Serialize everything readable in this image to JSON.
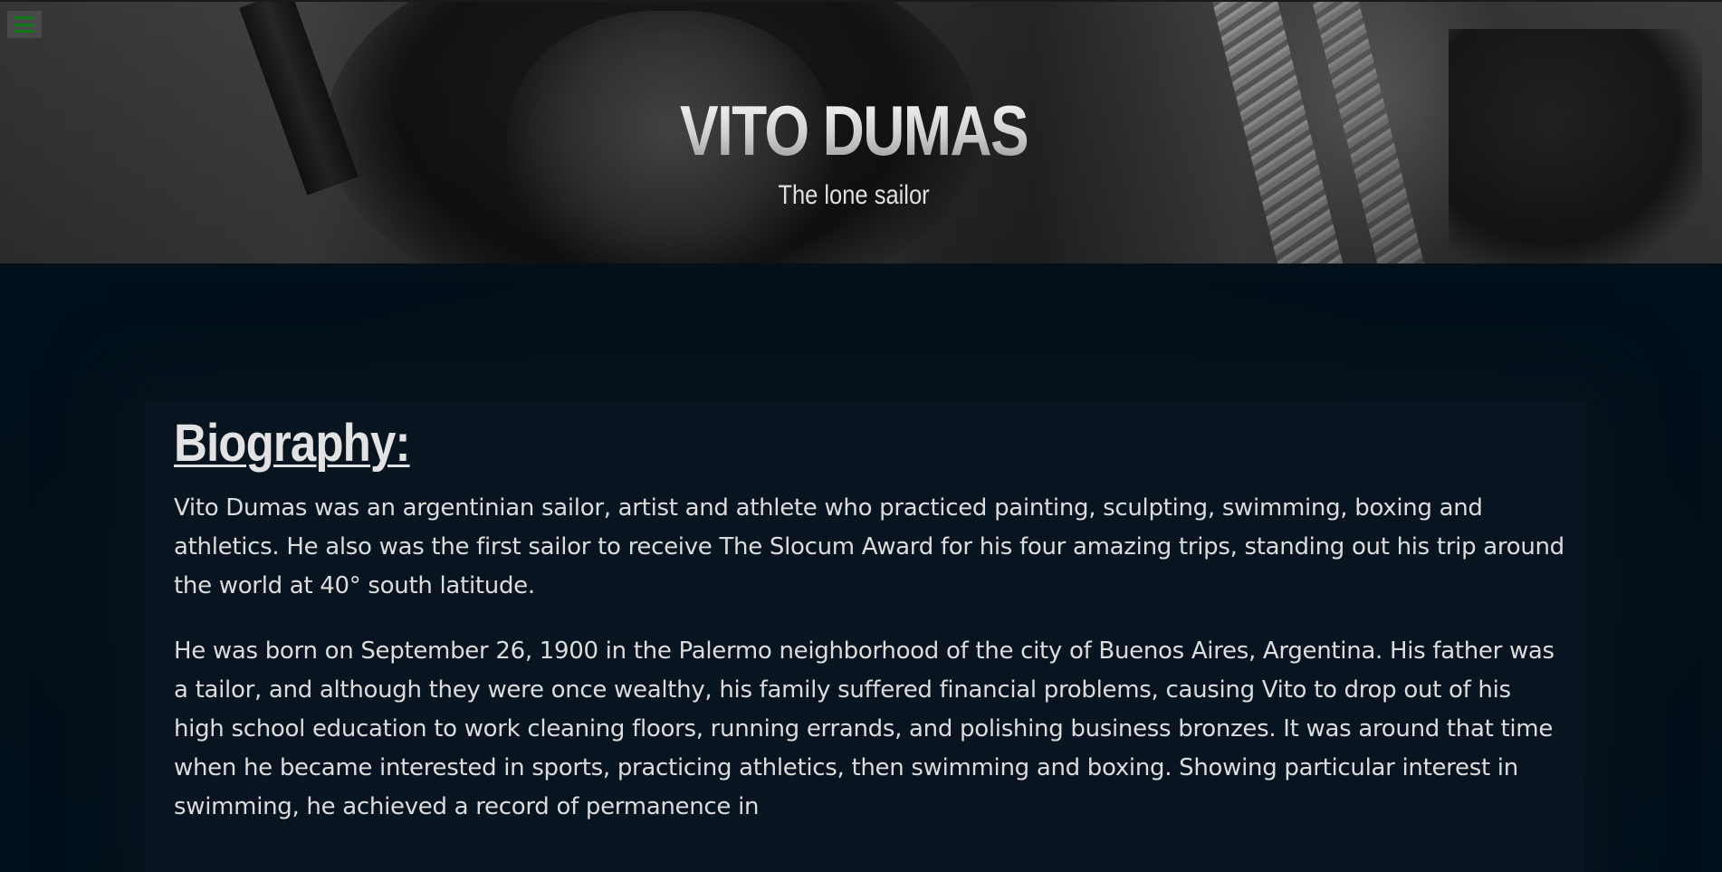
{
  "header": {
    "title": "VITO DUMAS",
    "subtitle": "The lone sailor",
    "menu_icon": "hamburger-menu-icon",
    "menu_icon_color": "#0b7a16"
  },
  "biography": {
    "heading": "Biography:",
    "paragraphs": [
      "Vito Dumas was an argentinian sailor, artist and athlete who practiced painting, sculpting, swimming, boxing and athletics. He also was the first sailor to receive The Slocum Award for his four amazing trips, standing out his trip around the world at 40° south latitude.",
      "He was born on September 26, 1900 in the Palermo neighborhood of the city of Buenos Aires, Argentina. His father was a tailor, and although they were once wealthy, his family suffered financial problems, causing Vito to drop out of his high school education to work cleaning floors, running errands, and polishing business bronzes. It was around that time when he became interested in sports, practicing athletics, then swimming and boxing. Showing particular interest in swimming, he achieved a record of permanence in"
    ]
  },
  "colors": {
    "page_background": "#02101b",
    "card_background": "#081520",
    "text": "#dcdcdc"
  }
}
